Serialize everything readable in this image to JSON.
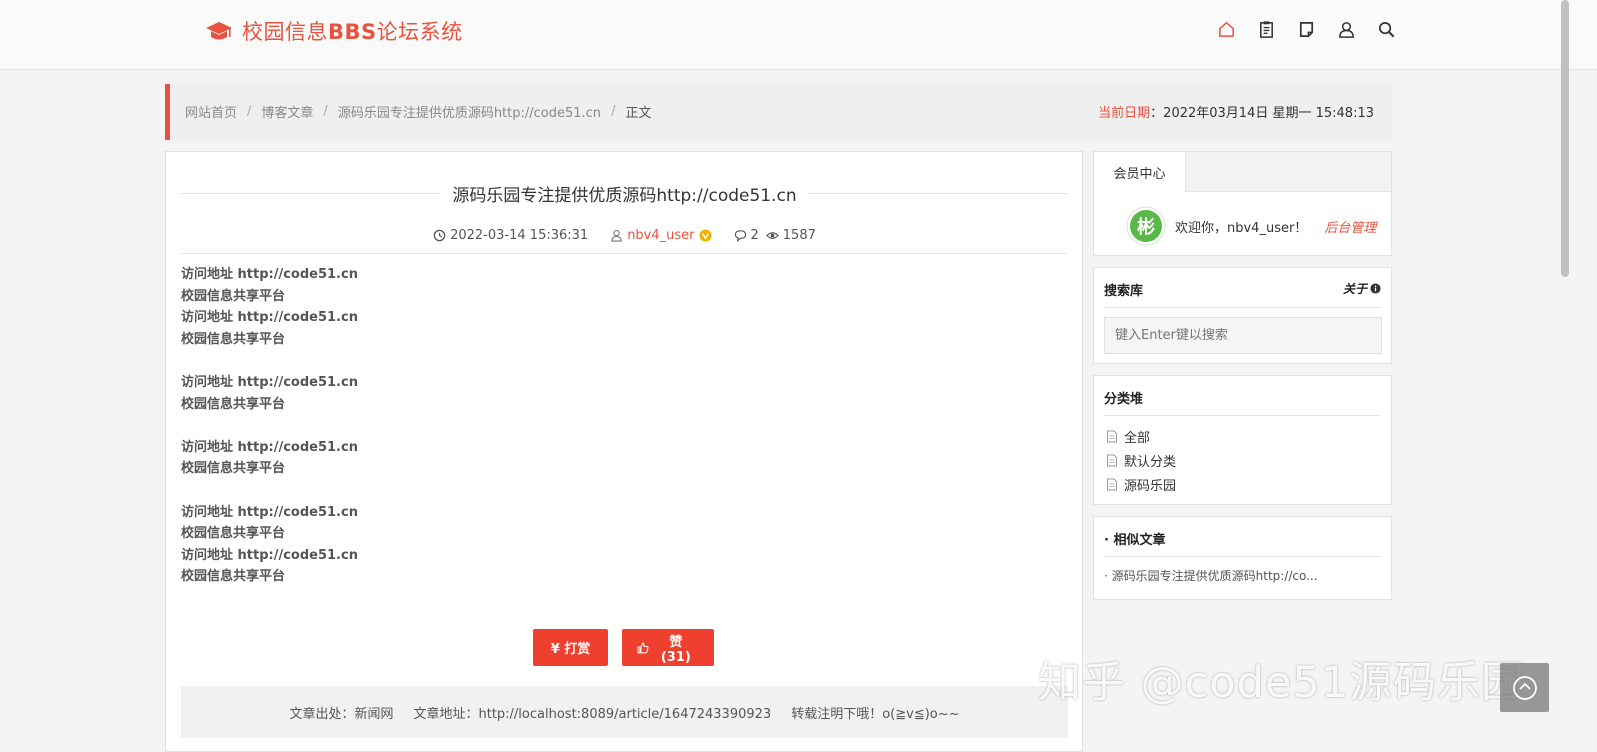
{
  "header": {
    "logo_text": "校园信息",
    "logo_bbs": "BBS",
    "logo_suffix": "论坛系统",
    "nav_icons": [
      "home-icon",
      "clipboard-icon",
      "note-icon",
      "user-icon",
      "search-icon"
    ]
  },
  "breadcrumb": {
    "items": [
      "网站首页",
      "博客文章",
      "源码乐园专注提供优质源码http://code51.cn",
      "正文"
    ],
    "separator": "/",
    "date_label": "当前日期",
    "date_value": "：2022年03月14日 星期一 15:48:13"
  },
  "article": {
    "title": "源码乐园专注提供优质源码http://code51.cn",
    "datetime": "2022-03-14 15:36:31",
    "author": "nbv4_user",
    "comments": "2",
    "views": "1587",
    "lines": [
      "访问地址 http://code51.cn",
      "校园信息共享平台",
      "访问地址 http://code51.cn",
      "校园信息共享平台",
      "",
      "访问地址 http://code51.cn",
      "校园信息共享平台",
      "",
      "访问地址 http://code51.cn",
      "校园信息共享平台",
      "",
      "访问地址 http://code51.cn",
      "校园信息共享平台",
      "访问地址 http://code51.cn",
      "校园信息共享平台"
    ],
    "reward_label": "¥ 打赏",
    "like_label": "赞 (31)",
    "source_from": "文章出处：新闻网",
    "source_url": "文章地址：http://localhost:8089/article/1647243390923",
    "source_note": "转载注明下哦！o(≧v≦)o~~"
  },
  "sidebar": {
    "member_tab": "会员中心",
    "welcome": "欢迎你，nbv4_user！",
    "admin_link": "后台管理",
    "search_title": "搜索库",
    "search_about": "关于",
    "search_placeholder": "键入Enter键以搜索",
    "category_title": "分类堆",
    "categories": [
      "全部",
      "默认分类",
      "源码乐园"
    ],
    "similar_title": "· 相似文章",
    "similar_items": [
      "· 源码乐园专注提供优质源码http://co..."
    ]
  },
  "watermark": "知乎 @code51源码乐园",
  "colors": {
    "accent": "#e8533f",
    "button": "#ee3f2f",
    "page_bg": "#f4f4f4"
  }
}
